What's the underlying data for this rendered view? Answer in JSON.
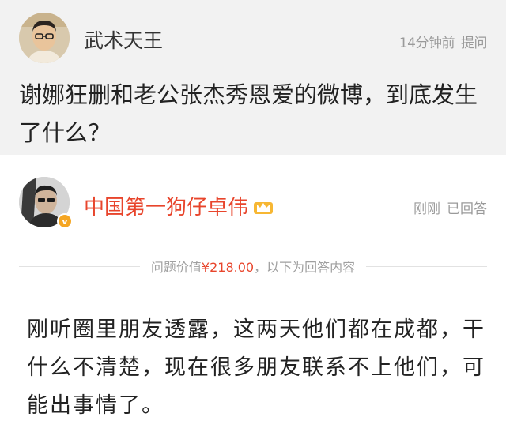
{
  "question": {
    "username": "武术天王",
    "time": "14分钟前",
    "action": "提问",
    "text": "谢娜狂删和老公张杰秀恩爱的微博，到底发生了什么？"
  },
  "answer": {
    "username": "中国第一狗仔卓伟",
    "verified_badge": "v",
    "time": "刚刚",
    "status": "已回答",
    "divider": {
      "prefix": "问题价值",
      "price": "¥218.00",
      "suffix": "，以下为回答内容"
    },
    "text": "刚听圈里朋友透露，这两天他们都在成都，干什么不清楚，现在很多朋友联系不上他们，可能出事情了。"
  },
  "colors": {
    "question_bg": "#f2f2f2",
    "accent_red": "#e8452c",
    "meta_gray": "#9a9a9a",
    "badge_orange": "#f5a623"
  },
  "icons": {
    "crown": "crown-icon",
    "verified": "verified-badge-icon"
  }
}
